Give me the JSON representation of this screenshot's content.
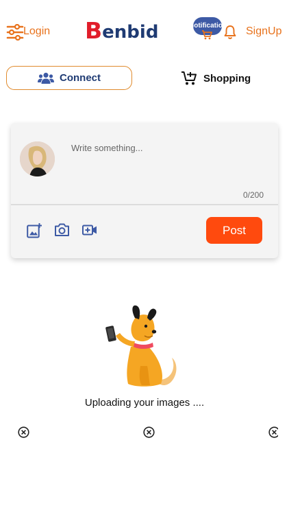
{
  "header": {
    "login_label": "Login",
    "logo_text_b": "B",
    "logo_text_rest": "enbid",
    "notification_label": "Notification",
    "signup_label": "SignUp"
  },
  "tabs": {
    "connect_label": "Connect",
    "shopping_label": "Shopping",
    "active": "Connect"
  },
  "composer": {
    "placeholder": "Write something...",
    "value": "",
    "char_count": "0/200",
    "post_label": "Post"
  },
  "upload": {
    "status_text": "Uploading your images ....",
    "pending_items": 3
  },
  "colors": {
    "accent_orange": "#e8721c",
    "brand_red": "#e11d2a",
    "brand_navy": "#1f3b73",
    "post_button": "#ff4a0e",
    "icon_blue": "#3d5aa5"
  },
  "icons": [
    "menu-sliders-icon",
    "notification-icon",
    "cart-icon",
    "bell-icon",
    "users-icon",
    "shopping-cart-icon",
    "add-image-icon",
    "camera-icon",
    "video-add-icon",
    "close-circle-icon"
  ]
}
